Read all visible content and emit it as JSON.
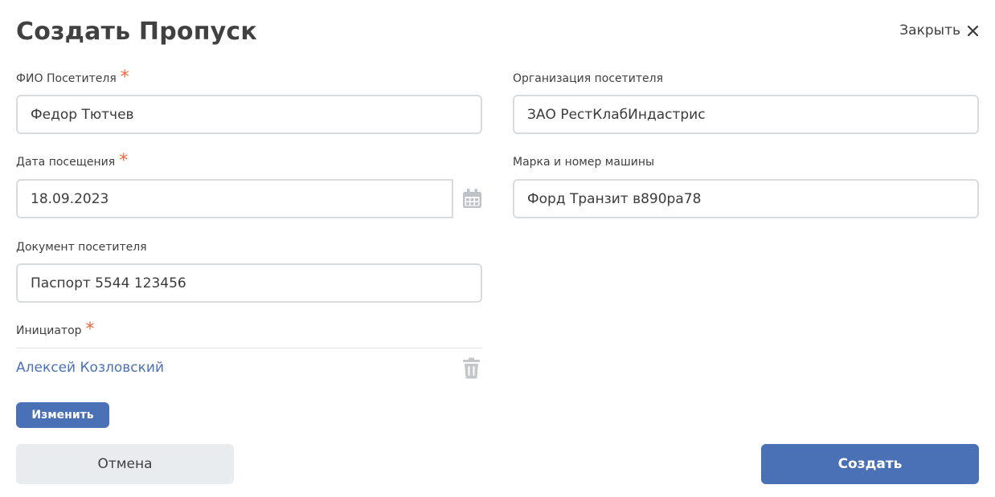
{
  "dialog": {
    "title": "Создать Пропуск",
    "close_label": "Закрыть"
  },
  "form": {
    "visitor_name": {
      "label": "ФИО Посетителя",
      "required_mark": "*",
      "value": "Федор Тютчев"
    },
    "visitor_org": {
      "label": "Организация посетителя",
      "value": "ЗАО РестКлабИндастрис"
    },
    "visit_date": {
      "label": "Дата посещения",
      "required_mark": "*",
      "value": "18.09.2023"
    },
    "car": {
      "label": "Марка и номер машины",
      "value": "Форд Транзит в890ра78"
    },
    "document": {
      "label": "Документ посетителя",
      "value": "Паспорт 5544 123456"
    },
    "initiator": {
      "label": "Инициатор",
      "required_mark": "*",
      "value": "Алексей Козловский"
    }
  },
  "buttons": {
    "change_label": "Изменить",
    "cancel_label": "Отмена",
    "create_label": "Создать"
  },
  "colors": {
    "primary": "#4a71b6",
    "required": "#f2673a",
    "secondary_button": "#e8ecee",
    "border": "#d9dcdf"
  },
  "icons": [
    "close-icon",
    "calendar-icon",
    "trash-icon"
  ]
}
